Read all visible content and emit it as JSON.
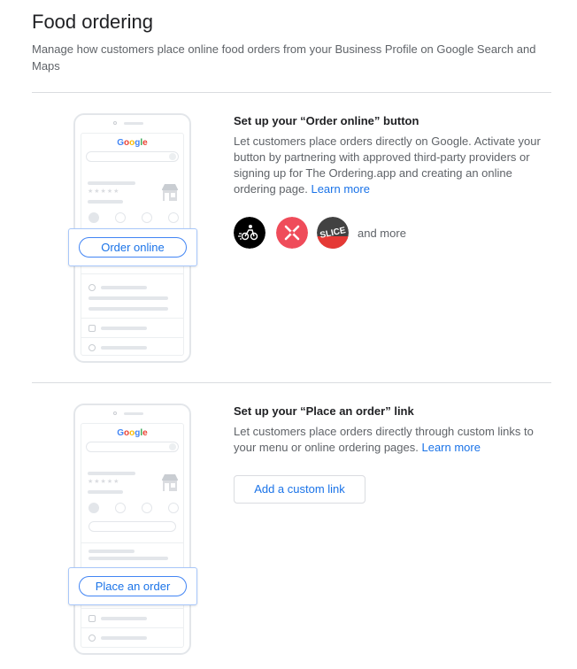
{
  "page": {
    "title": "Food ordering",
    "description": "Manage how customers place online food orders from your Business Profile on Google Search and Maps"
  },
  "mockup": {
    "google_logo": {
      "g1": "G",
      "o1": "o",
      "o2": "o",
      "g2": "g",
      "l": "l",
      "e": "e"
    },
    "stars": "★★★★★"
  },
  "order_online": {
    "title": "Set up your “Order online” button",
    "description": "Let customers place orders directly on Google. Activate your button by partnering with approved third-party providers or signing up for The Ordering.app and creating an online ordering page.",
    "learn_more": "Learn more",
    "mock_button_label": "Order online",
    "providers": [
      {
        "icon": "courier-bike-icon",
        "color": "#000000"
      },
      {
        "icon": "fork-knife-pin-icon",
        "color": "#ef4c5a"
      },
      {
        "icon": "slice-logo-icon",
        "color": "#e53935",
        "logo_text": "SLICE"
      }
    ],
    "and_more": "and more"
  },
  "place_order": {
    "title": "Set up your “Place an order” link",
    "description": "Let customers place orders directly through custom links to your menu or online ordering pages.",
    "learn_more": "Learn more",
    "mock_button_label": "Place an order",
    "add_link_button": "Add a custom link"
  },
  "colors": {
    "accent": "#1a73e8",
    "divider": "#dadce0",
    "muted_text": "#5f6368"
  }
}
